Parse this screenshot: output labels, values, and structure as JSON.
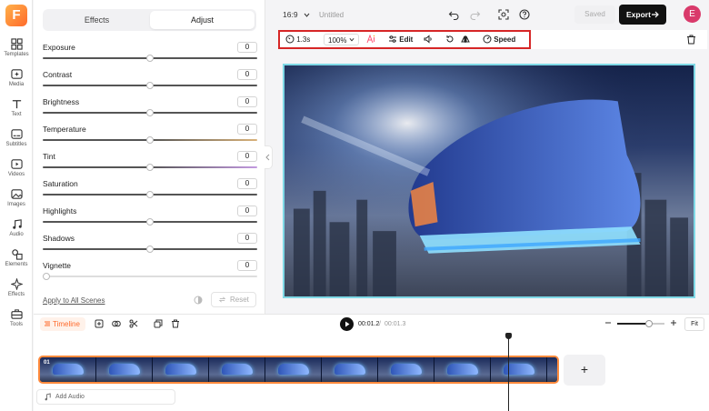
{
  "app": {
    "logo_letter": "F"
  },
  "sidebar": {
    "items": [
      {
        "label": "Templates",
        "icon": "grid-icon"
      },
      {
        "label": "Media",
        "icon": "folder-plus-icon"
      },
      {
        "label": "Text",
        "icon": "text-icon"
      },
      {
        "label": "Subtitles",
        "icon": "subtitles-icon"
      },
      {
        "label": "Videos",
        "icon": "play-circle-icon"
      },
      {
        "label": "Images",
        "icon": "image-icon"
      },
      {
        "label": "Audio",
        "icon": "music-note-icon"
      },
      {
        "label": "Elements",
        "icon": "shapes-icon"
      },
      {
        "label": "Effects",
        "icon": "sparkle-icon"
      },
      {
        "label": "Tools",
        "icon": "toolbox-icon"
      }
    ],
    "active_item": "Effects"
  },
  "panel": {
    "tabs": [
      {
        "label": "Effects"
      },
      {
        "label": "Adjust"
      }
    ],
    "active_tab": "Adjust",
    "adjustments": [
      {
        "label": "Exposure",
        "value": "0",
        "level": 0.5
      },
      {
        "label": "Contrast",
        "value": "0",
        "level": 0.5
      },
      {
        "label": "Brightness",
        "value": "0",
        "level": 0.5
      },
      {
        "label": "Temperature",
        "value": "0",
        "level": 0.5
      },
      {
        "label": "Tint",
        "value": "0",
        "level": 0.5
      },
      {
        "label": "Saturation",
        "value": "0",
        "level": 0.5
      },
      {
        "label": "Highlights",
        "value": "0",
        "level": 0.5
      },
      {
        "label": "Shadows",
        "value": "0",
        "level": 0.5
      },
      {
        "label": "Vignette",
        "value": "0",
        "level": 0.0
      }
    ],
    "apply_all_label": "Apply to All Scenes",
    "reset_label": "Reset"
  },
  "header": {
    "aspect_ratio": "16:9",
    "project_title": "Untitled",
    "saved_label": "Saved",
    "export_label": "Export",
    "avatar_letter": "E"
  },
  "toolbar": {
    "duration": "1.3s",
    "zoom": "100%",
    "edit_label": "Edit",
    "speed_label": "Speed"
  },
  "timeline": {
    "timeline_label": "Timeline",
    "current_time": "00:01.2",
    "separator": "/",
    "total_time": "00:01.3",
    "zoom_level": 0.68,
    "fit_label": "Fit",
    "clip_label": "01",
    "add_scene_label": "+",
    "add_audio_label": "Add Audio"
  },
  "colors": {
    "accent": "#ff6a2b",
    "highlight_box": "#d62626",
    "canvas_border": "#7fd9e6",
    "avatar": "#d93a6b"
  }
}
